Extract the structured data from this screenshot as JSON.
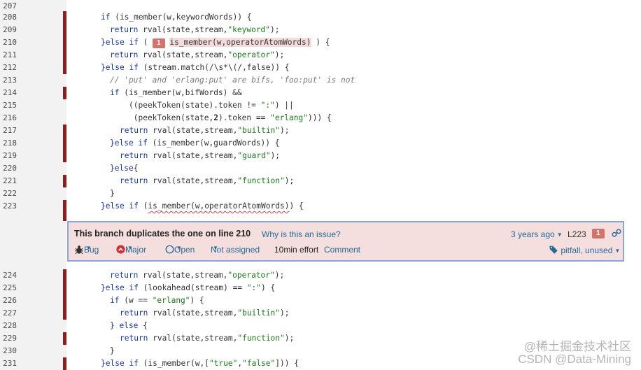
{
  "lines": [
    {
      "n": "207"
    },
    {
      "n": "208"
    },
    {
      "n": "209"
    },
    {
      "n": "210"
    },
    {
      "n": "211"
    },
    {
      "n": "212"
    },
    {
      "n": "213"
    },
    {
      "n": "214"
    },
    {
      "n": "215"
    },
    {
      "n": "216"
    },
    {
      "n": "217"
    },
    {
      "n": "218"
    },
    {
      "n": "219"
    },
    {
      "n": "220"
    },
    {
      "n": "221"
    },
    {
      "n": "222"
    },
    {
      "n": "223"
    },
    {
      "n": "224"
    },
    {
      "n": "225"
    },
    {
      "n": "226"
    },
    {
      "n": "227"
    },
    {
      "n": "228"
    },
    {
      "n": "229"
    },
    {
      "n": "230"
    },
    {
      "n": "231"
    }
  ],
  "code": {
    "l208": [
      "if",
      " (is_member(w,keywordWords)) {"
    ],
    "l209": [
      "return",
      " rval(state,stream,",
      "\"keyword\"",
      ");"
    ],
    "l210": [
      "}else if",
      " ( ",
      "1",
      "is_member(w,operatorAtomWords)",
      " ) {"
    ],
    "l211": [
      "return",
      " rval(state,stream,",
      "\"operator\"",
      ");"
    ],
    "l212": [
      "}else if",
      " (stream.match(/\\s*\\(/,false)) {"
    ],
    "l213": "// 'put' and 'erlang:put' are bifs, 'foo:put' is not",
    "l214": [
      "if",
      " (is_member(w,bifWords) &&"
    ],
    "l215": [
      "((peekToken(state).token != ",
      "\":\"",
      ") ||"
    ],
    "l216": [
      " (peekToken(state,",
      "2",
      ").token == ",
      "\"erlang\"",
      "))) {"
    ],
    "l217": [
      "return",
      " rval(state,stream,",
      "\"builtin\"",
      ");"
    ],
    "l218": [
      "}else if",
      " (is_member(w,guardWords)) {"
    ],
    "l219": [
      "return",
      " rval(state,stream,",
      "\"guard\"",
      ");"
    ],
    "l220": [
      "}else",
      "{"
    ],
    "l221": [
      "return",
      " rval(state,stream,",
      "\"function\"",
      ");"
    ],
    "l222": "}",
    "l223": [
      "}else if",
      " (",
      "is_member(w,operatorAtomWords)",
      ") {"
    ],
    "l224": [
      "return",
      " rval(state,stream,",
      "\"operator\"",
      ");"
    ],
    "l225": [
      "}else if",
      " (lookahead(stream) == ",
      "\":\"",
      ") {"
    ],
    "l226": [
      "if",
      " (w == ",
      "\"erlang\"",
      ") {"
    ],
    "l227": [
      "return",
      " rval(state,stream,",
      "\"builtin\"",
      ");"
    ],
    "l228": [
      "} else",
      " {"
    ],
    "l229": [
      "return",
      " rval(state,stream,",
      "\"function\"",
      ");"
    ],
    "l230": "}",
    "l231": [
      "}else if",
      " (is_member(w,[",
      "\"true\"",
      ",",
      "\"false\"",
      "])) {"
    ]
  },
  "issue": {
    "title": "This branch duplicates the one on line 210",
    "why": "Why is this an issue?",
    "ago": "3 years ago",
    "line_ref": "L223",
    "count": "1",
    "type": "Bug",
    "severity": "Major",
    "status": "Open",
    "assignee": "Not assigned",
    "effort": "10min effort",
    "comment": "Comment",
    "tags": "pitfall, unused"
  },
  "watermark": "@稀土掘金技术社区\nCSDN @Data-Mining"
}
